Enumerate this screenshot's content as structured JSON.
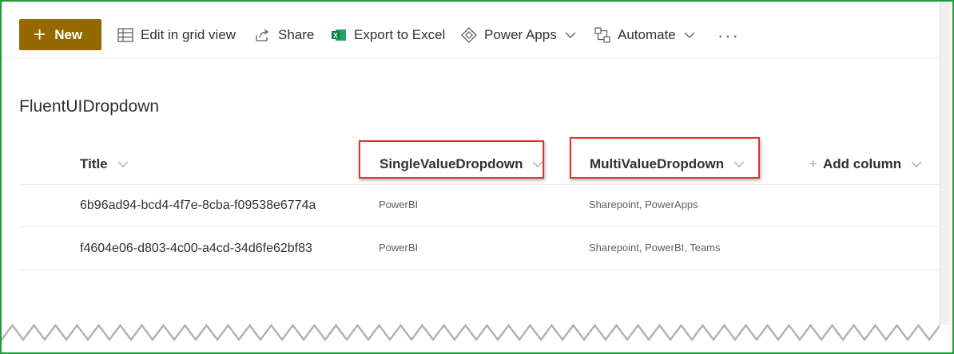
{
  "toolbar": {
    "new_label": "New",
    "edit_grid_label": "Edit in grid view",
    "share_label": "Share",
    "export_label": "Export to Excel",
    "power_apps_label": "Power Apps",
    "automate_label": "Automate",
    "more_label": "···"
  },
  "list": {
    "title": "FluentUIDropdown",
    "columns": {
      "title": "Title",
      "single": "SingleValueDropdown",
      "multi": "MultiValueDropdown",
      "add": "Add column",
      "add_plus": "+"
    },
    "rows": [
      {
        "title": "6b96ad94-bcd4-4f7e-8cba-f09538e6774a",
        "single": "PowerBI",
        "multi": "Sharepoint, PowerApps"
      },
      {
        "title": "f4604e06-d803-4c00-a4cd-34d6fe62bf83",
        "single": "PowerBI",
        "multi": "Sharepoint, PowerBI, Teams"
      }
    ]
  },
  "colors": {
    "new_button_bg": "#946a00",
    "highlight_border": "#e03232",
    "frame_border": "#1f9d3a",
    "excel_green": "#107c41"
  }
}
